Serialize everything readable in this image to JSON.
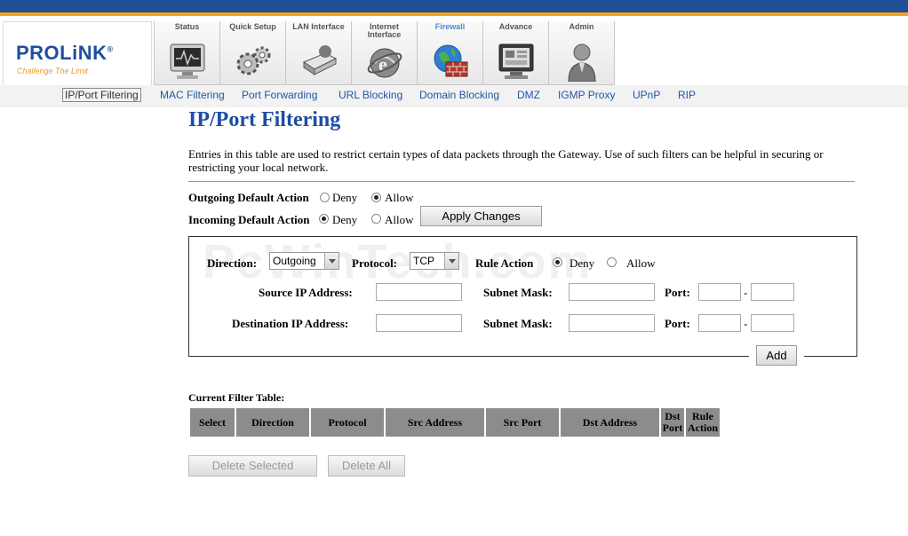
{
  "brand": {
    "logo": "PROLiNK",
    "registered": "®",
    "tagline": "Challenge The Limit"
  },
  "tabs": [
    {
      "label": "Status",
      "icon": "monitor-icon"
    },
    {
      "label": "Quick Setup",
      "icon": "gears-icon"
    },
    {
      "label": "LAN Interface",
      "icon": "drive-icon"
    },
    {
      "label": "Internet Interface",
      "icon": "ie-globe-icon"
    },
    {
      "label": "Firewall",
      "icon": "firewall-globe-icon",
      "active": true
    },
    {
      "label": "Advance",
      "icon": "advance-screen-icon"
    },
    {
      "label": "Admin",
      "icon": "admin-user-icon"
    }
  ],
  "subnav": [
    {
      "label": "IP/Port Filtering",
      "active": true
    },
    {
      "label": "MAC Filtering"
    },
    {
      "label": "Port Forwarding"
    },
    {
      "label": "URL Blocking"
    },
    {
      "label": "Domain Blocking"
    },
    {
      "label": "DMZ"
    },
    {
      "label": "IGMP Proxy"
    },
    {
      "label": "UPnP"
    },
    {
      "label": "RIP"
    }
  ],
  "page": {
    "title": "IP/Port Filtering",
    "description": "Entries in this table are used to restrict certain types of data packets through the Gateway. Use of such filters can be helpful in securing or restricting your local network."
  },
  "defaults": {
    "outgoing_label": "Outgoing Default Action",
    "incoming_label": "Incoming Default Action",
    "deny": "Deny",
    "allow": "Allow",
    "outgoing_selected": "Allow",
    "incoming_selected": "Deny",
    "apply_button": "Apply Changes"
  },
  "form": {
    "watermark": "PcWinTech.com",
    "direction_label": "Direction:",
    "direction_value": "Outgoing",
    "protocol_label": "Protocol:",
    "protocol_value": "TCP",
    "rule_action_label": "Rule Action",
    "rule_deny": "Deny",
    "rule_allow": "Allow",
    "rule_selected": "Deny",
    "source_ip_label": "Source IP Address:",
    "dest_ip_label": "Destination IP Address:",
    "subnet_mask_label": "Subnet Mask:",
    "port_label": "Port:",
    "port_separator": "-",
    "add_button": "Add"
  },
  "table": {
    "title": "Current Filter Table:",
    "columns": [
      "Select",
      "Direction",
      "Protocol",
      "Src Address",
      "Src Port",
      "Dst Address",
      "Dst Port",
      "Rule Action"
    ],
    "rows": []
  },
  "actions": {
    "delete_selected": "Delete Selected",
    "delete_all": "Delete All"
  }
}
